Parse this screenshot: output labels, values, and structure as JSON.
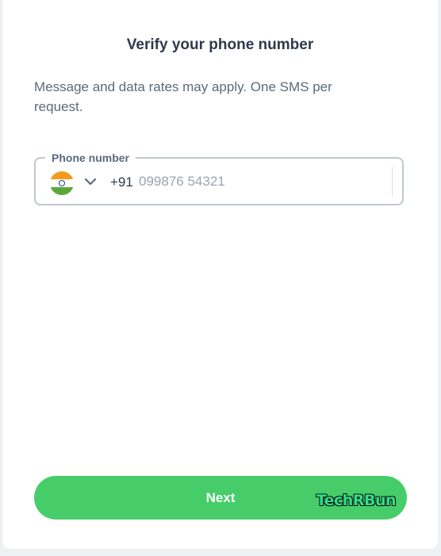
{
  "header": {
    "title": "Verify your phone number"
  },
  "description": "Message and data rates may apply. One SMS per request.",
  "phone": {
    "label": "Phone number",
    "country_flag": "india-flag-icon",
    "country_code": "+91",
    "placeholder": "099876 54321",
    "value": ""
  },
  "actions": {
    "next_label": "Next"
  },
  "watermark": "TechRBun",
  "colors": {
    "primary_button": "#46cd6a",
    "title_text": "#2f3a4b",
    "body_text": "#5b6a7c",
    "field_border": "#bfc7d1"
  }
}
